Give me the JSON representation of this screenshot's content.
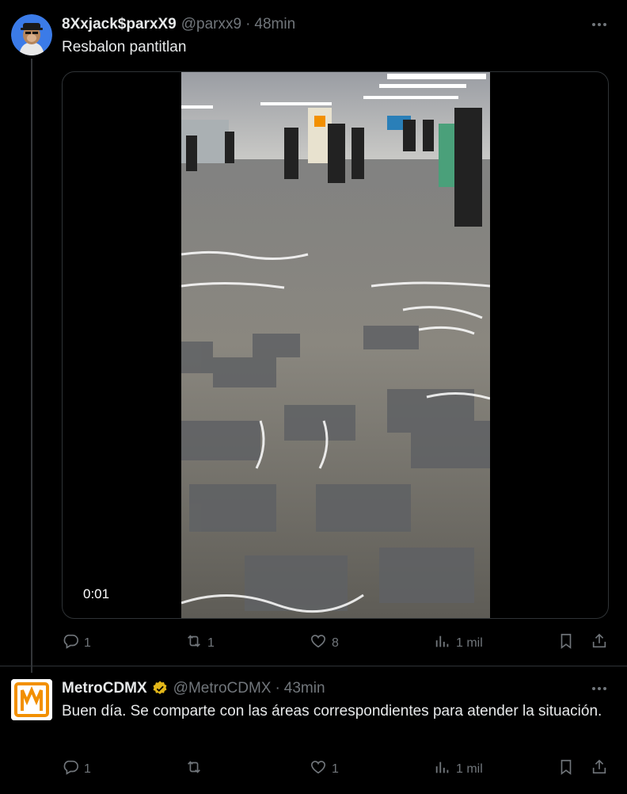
{
  "tweets": [
    {
      "display_name": "8Xxjack$parxX9",
      "handle": "@parxx9",
      "time": "48min",
      "text": "Resbalon pantitlan",
      "media": {
        "type": "video",
        "timestamp": "0:01"
      },
      "actions": {
        "replies": "1",
        "reposts": "1",
        "likes": "8",
        "views": "1 mil"
      }
    },
    {
      "display_name": "MetroCDMX",
      "verified": true,
      "handle": "@MetroCDMX",
      "time": "43min",
      "text": "Buen día. Se comparte con las áreas correspondientes para atender la situación.",
      "actions": {
        "replies": "1",
        "reposts": "",
        "likes": "1",
        "views": "1 mil"
      }
    }
  ],
  "separator": "·",
  "colors": {
    "background": "#000000",
    "text": "#e7e9ea",
    "secondary": "#71767b",
    "verified": "#e2b719",
    "metro_logo": "#f29000"
  }
}
